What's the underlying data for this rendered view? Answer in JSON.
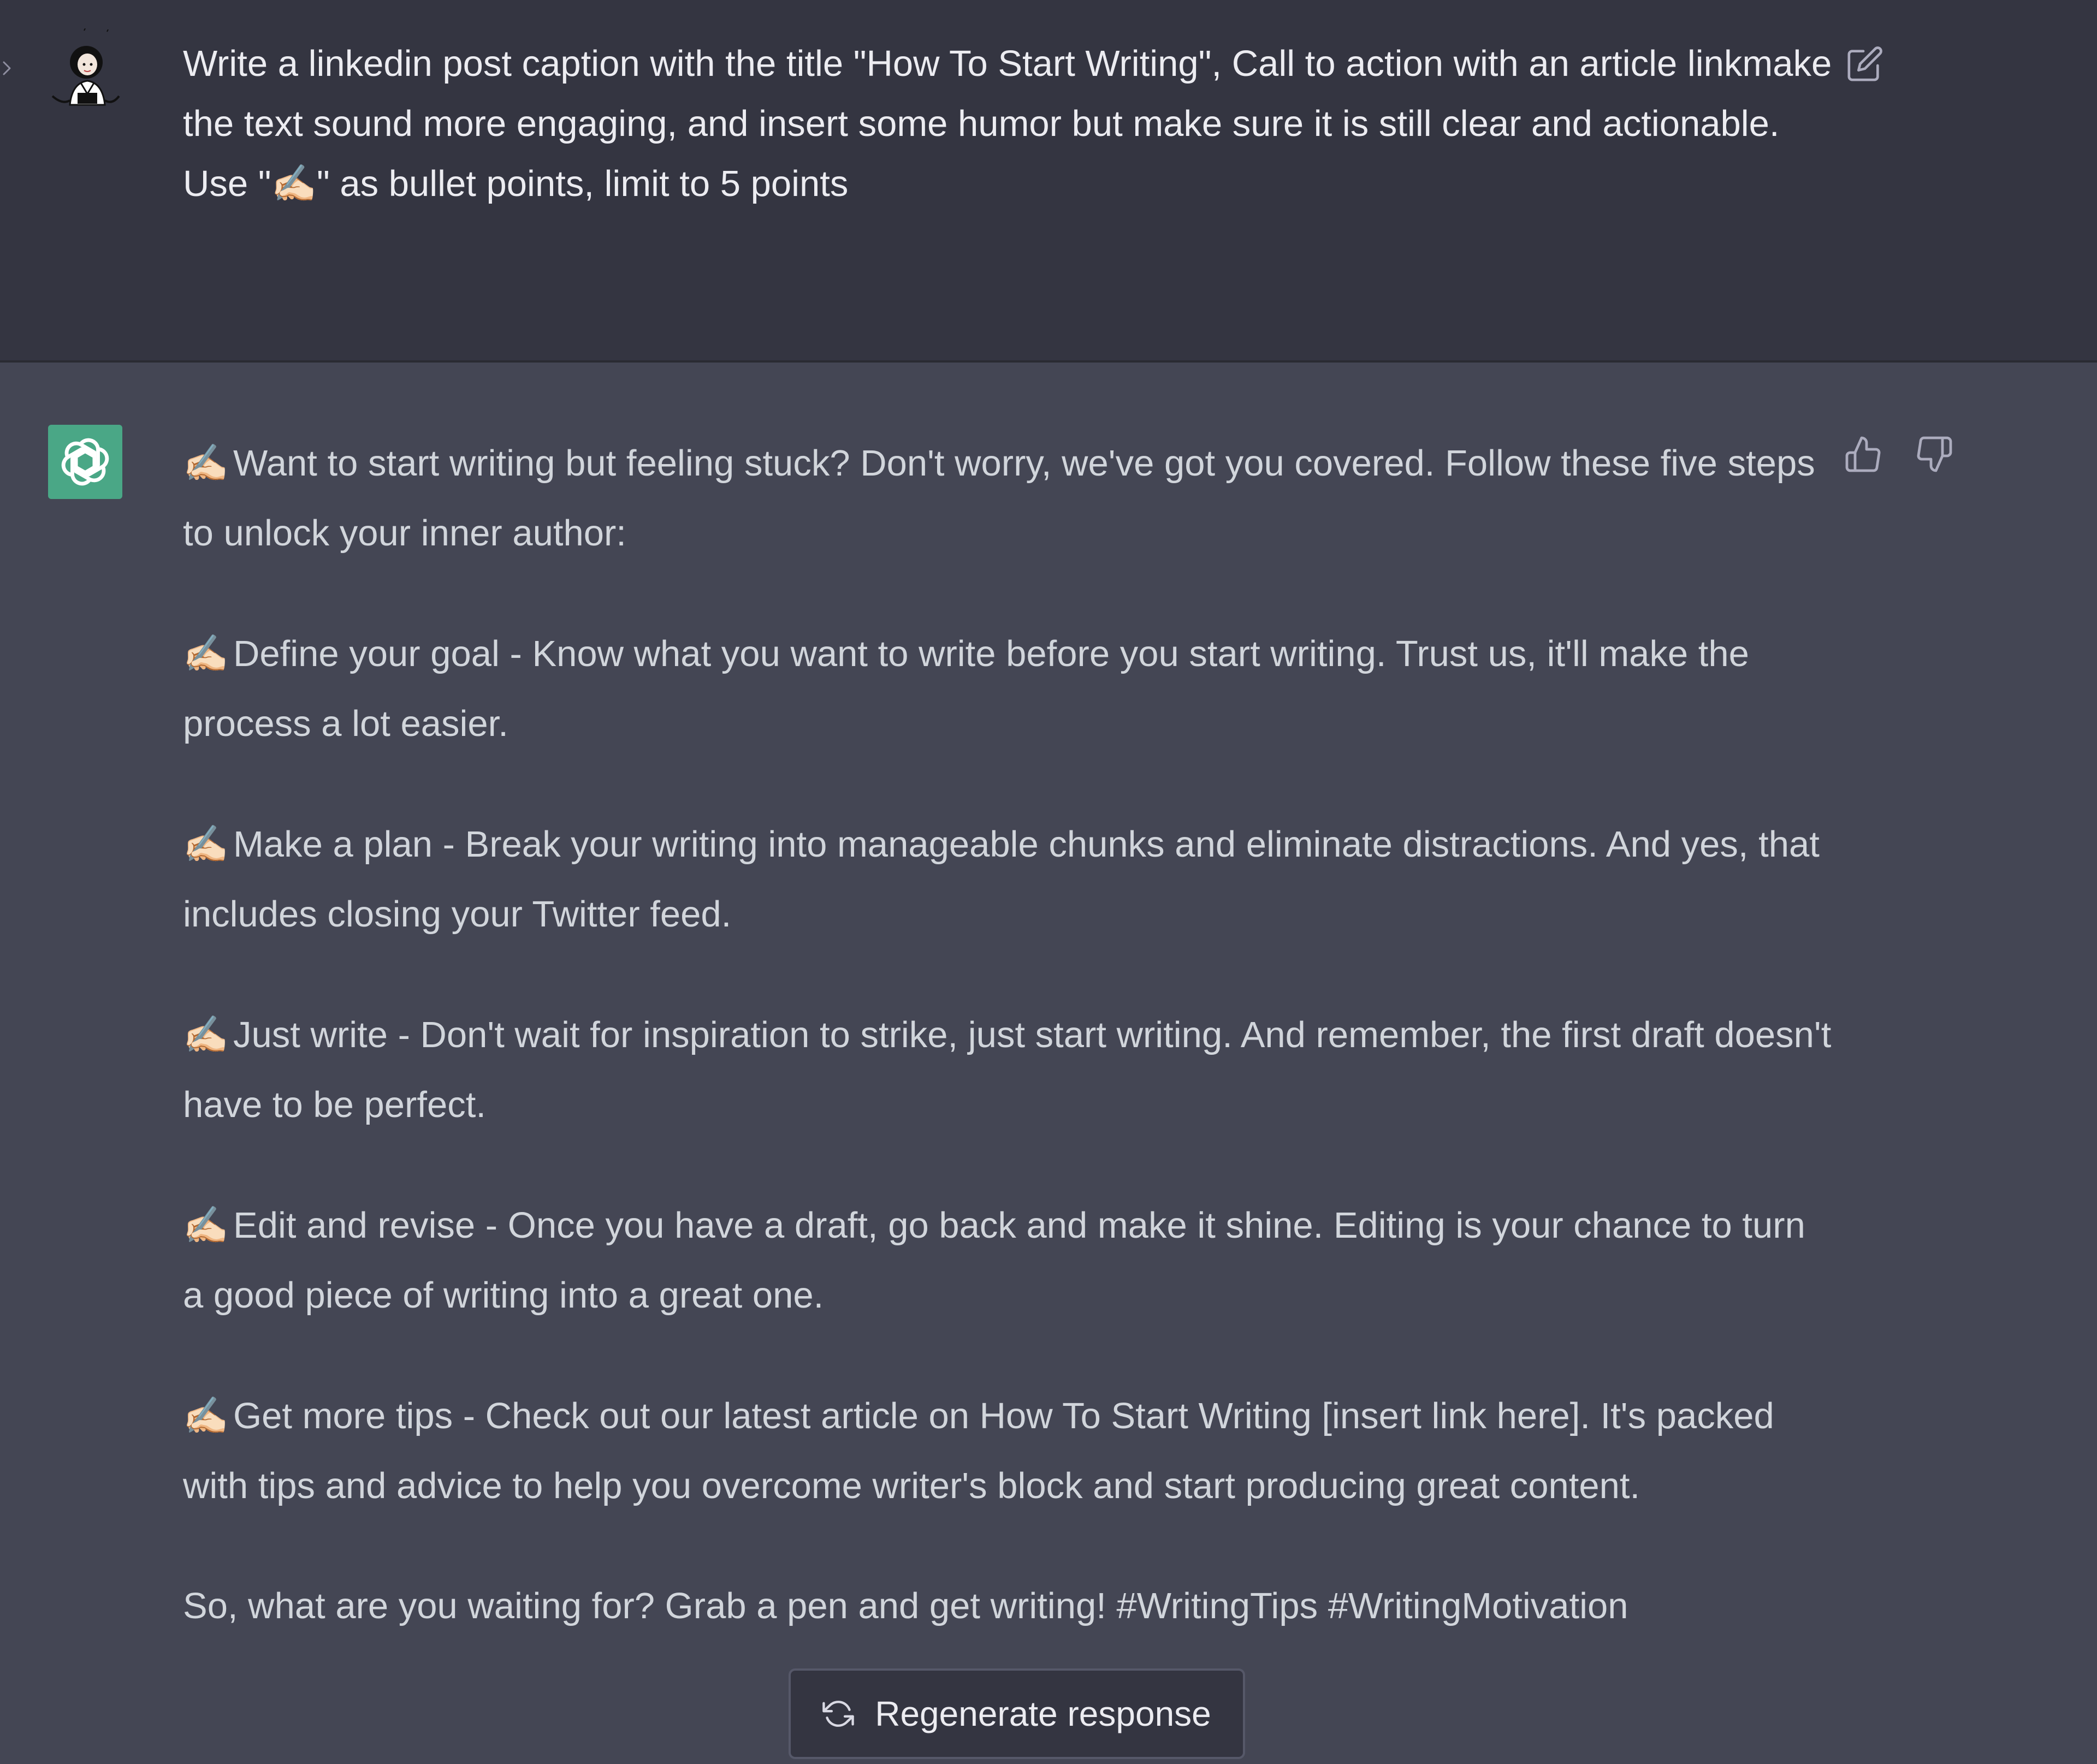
{
  "user_message": {
    "text": "Write a linkedin post caption with the title \"How To Start Writing\", Call to action with an article linkmake the text sound more engaging, and insert some humor but make sure it is still clear and actionable. Use \"✍🏻\" as bullet points, limit to 5 points"
  },
  "assistant_message": {
    "bullet_glyph": "✍🏻",
    "intro": "Want to start writing but feeling stuck? Don't worry, we've got you covered. Follow these five steps to unlock your inner author:",
    "points": [
      "Define your goal - Know what you want to write before you start writing. Trust us, it'll make the process a lot easier.",
      "Make a plan - Break your writing into manageable chunks and eliminate distractions. And yes, that includes closing your Twitter feed.",
      "Just write - Don't wait for inspiration to strike, just start writing. And remember, the first draft doesn't have to be perfect.",
      "Edit and revise - Once you have a draft, go back and make it shine. Editing is your chance to turn a good piece of writing into a great one.",
      "Get more tips - Check out our latest article on How To Start Writing [insert link here]. It's packed with tips and advice to help you overcome writer's block and start producing great content."
    ],
    "closing": "So, what are you waiting for? Grab a pen and get writing! #WritingTips #WritingMotivation"
  },
  "regenerate_button": {
    "label": "Regenerate response"
  },
  "icons": {
    "sidebar_toggle": "chevron-right-icon",
    "edit": "edit-icon",
    "thumbs_up": "thumbs-up-icon",
    "thumbs_down": "thumbs-down-icon",
    "regenerate": "refresh-icon",
    "assistant_logo": "openai-logo-icon"
  },
  "colors": {
    "user_bg": "#343541",
    "assistant_bg": "#444654",
    "avatar_green": "#4aa786",
    "text": "#ececf1"
  }
}
